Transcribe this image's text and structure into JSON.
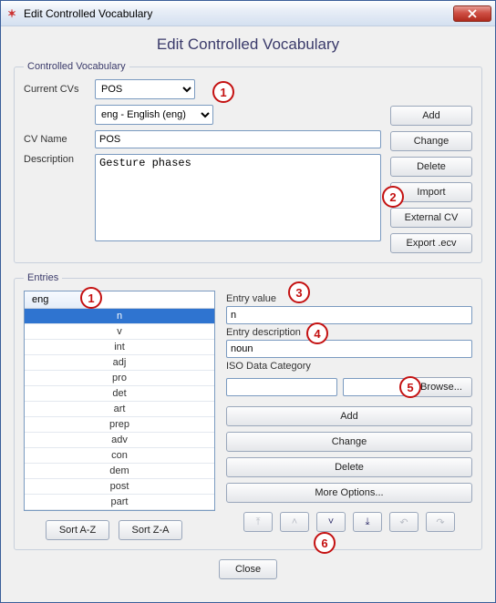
{
  "window": {
    "title": "Edit Controlled Vocabulary"
  },
  "page_title": "Edit Controlled Vocabulary",
  "cv_section": {
    "legend": "Controlled Vocabulary",
    "current_cv_label": "Current CVs",
    "current_cv_value": "POS",
    "language_value": "eng - English (eng)",
    "cv_name_label": "CV Name",
    "cv_name_value": "POS",
    "description_label": "Description",
    "description_value": "Gesture phases",
    "buttons": {
      "add": "Add",
      "change": "Change",
      "delete": "Delete",
      "import": "Import",
      "external": "External CV",
      "export": "Export .ecv"
    }
  },
  "entries_section": {
    "legend": "Entries",
    "column_header": "eng",
    "items": [
      {
        "label": "n",
        "selected": true
      },
      {
        "label": "v"
      },
      {
        "label": "int"
      },
      {
        "label": "adj"
      },
      {
        "label": "pro"
      },
      {
        "label": "det"
      },
      {
        "label": "art"
      },
      {
        "label": "prep"
      },
      {
        "label": "adv"
      },
      {
        "label": "con"
      },
      {
        "label": "dem"
      },
      {
        "label": "post"
      },
      {
        "label": "part"
      }
    ],
    "sort_az": "Sort A-Z",
    "sort_za": "Sort Z-A",
    "entry_value_label": "Entry value",
    "entry_value": "n",
    "entry_desc_label": "Entry description",
    "entry_desc": "noun",
    "iso_label": "ISO Data Category",
    "browse": "Browse...",
    "buttons": {
      "add": "Add",
      "change": "Change",
      "delete": "Delete",
      "more": "More Options..."
    }
  },
  "close_label": "Close",
  "annotations": {
    "b1": "1",
    "b1b": "1",
    "b2": "2",
    "b3": "3",
    "b4": "4",
    "b5": "5",
    "b6": "6"
  }
}
